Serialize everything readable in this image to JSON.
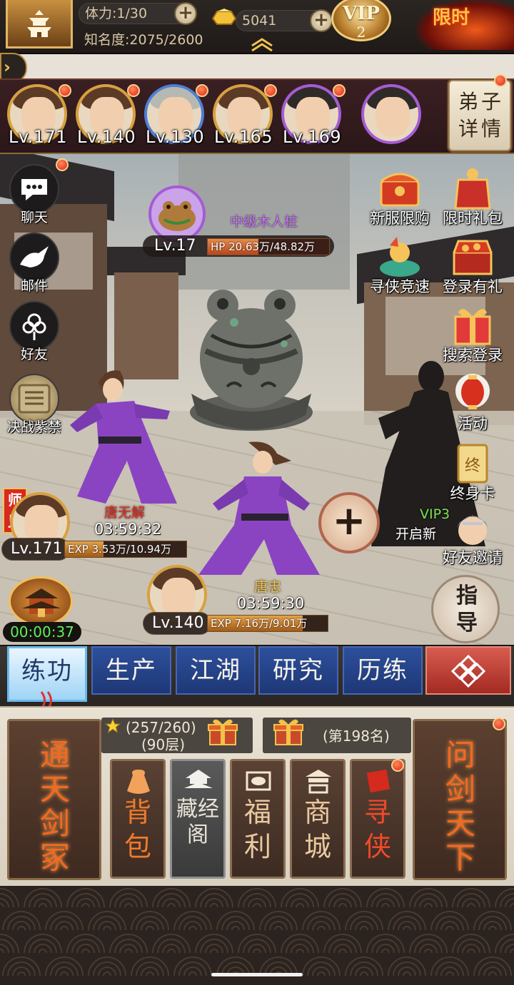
{
  "topbar": {
    "stamina": "体力:1/30",
    "fame": "知名度:2075/2600",
    "gold": "5041",
    "vip_label": "VIP",
    "vip_level": "2",
    "event_text": "限时"
  },
  "disciples": [
    {
      "level": "Lv.171",
      "frame": "gold",
      "hair": "brown",
      "alert": true
    },
    {
      "level": "Lv.140",
      "frame": "gold",
      "hair": "brown",
      "alert": true
    },
    {
      "level": "Lv.130",
      "frame": "blue",
      "hair": "grey",
      "alert": true
    },
    {
      "level": "Lv.165",
      "frame": "gold",
      "hair": "brown",
      "alert": true
    },
    {
      "level": "Lv.169",
      "frame": "purple",
      "hair": "dark",
      "alert": true
    },
    {
      "level": "",
      "frame": "purple",
      "hair": "dark",
      "alert": false
    }
  ],
  "disciple_detail_label": "弟子详情",
  "left_menu": [
    {
      "label": "聊天",
      "icon": "chat-icon"
    },
    {
      "label": "邮件",
      "icon": "dove-icon"
    },
    {
      "label": "好友",
      "icon": "flower-icon"
    },
    {
      "label": "决战紫禁",
      "icon": "seal-icon"
    }
  ],
  "enemy": {
    "name": "中级木人桩",
    "level": "Lv.17",
    "hp_text": "HP 20.63万/48.82万",
    "hp_fraction": 0.42
  },
  "senior": {
    "tag": "师兄",
    "name": "唐无解",
    "timer": "03:59:32",
    "level": "Lv.171",
    "exp_text": "EXP 3.53万/10.94万",
    "exp_fraction": 0.32
  },
  "junior": {
    "name": "唐忠",
    "timer": "03:59:30",
    "level": "Lv.140",
    "exp_text": "EXP 7.16万/9.01万",
    "exp_fraction": 0.79
  },
  "palace_timer": "00:00:37",
  "vip_unlock": {
    "vip": "VIP3",
    "text": "开启新"
  },
  "right_menu": [
    {
      "label": "新服限购",
      "icon": "chest-icon"
    },
    {
      "label": "限时礼包",
      "icon": "gift-bag-icon"
    },
    {
      "label": "寻侠竞速",
      "icon": "race-icon"
    },
    {
      "label": "登录有礼",
      "icon": "treasure-icon"
    },
    {
      "label": "搜索登录",
      "icon": "red-gift-icon"
    },
    {
      "label": "活动",
      "icon": "lantern-icon"
    },
    {
      "label": "终身卡",
      "icon": "card-icon"
    },
    {
      "label": "好友邀请",
      "icon": "invite-icon"
    }
  ],
  "guide_label": "指导",
  "tabs": [
    {
      "label": "练功",
      "active": true
    },
    {
      "label": "生产",
      "active": false
    },
    {
      "label": "江湖",
      "active": false
    },
    {
      "label": "研究",
      "active": false
    },
    {
      "label": "历练",
      "active": false
    }
  ],
  "panel": {
    "left_card": "通天剑冢",
    "right_card": "问剑天下",
    "tower_progress": "(257/260)",
    "tower_floor": "(90层)",
    "rank": "(第198名)",
    "buttons": [
      {
        "label": "背包",
        "icon": "bag-icon",
        "color": "#f07a2a",
        "style": "brown"
      },
      {
        "label": "藏经阁",
        "icon": "pavilion-icon",
        "color": "#e9e3d6",
        "style": "grey"
      },
      {
        "label": "福利",
        "icon": "ingot-icon",
        "color": "#e9c9a0",
        "style": "brown"
      },
      {
        "label": "商城",
        "icon": "shop-icon",
        "color": "#e9c9a0",
        "style": "brown"
      },
      {
        "label": "寻侠",
        "icon": "scroll-icon",
        "color": "#f04a2a",
        "style": "brown"
      }
    ]
  },
  "colors": {
    "gold": "#d8a03e",
    "purple": "#a55bd6",
    "alert_red": "#e2231a",
    "tab_blue": "#2d4f9c",
    "timer_green": "#5ff05a"
  }
}
